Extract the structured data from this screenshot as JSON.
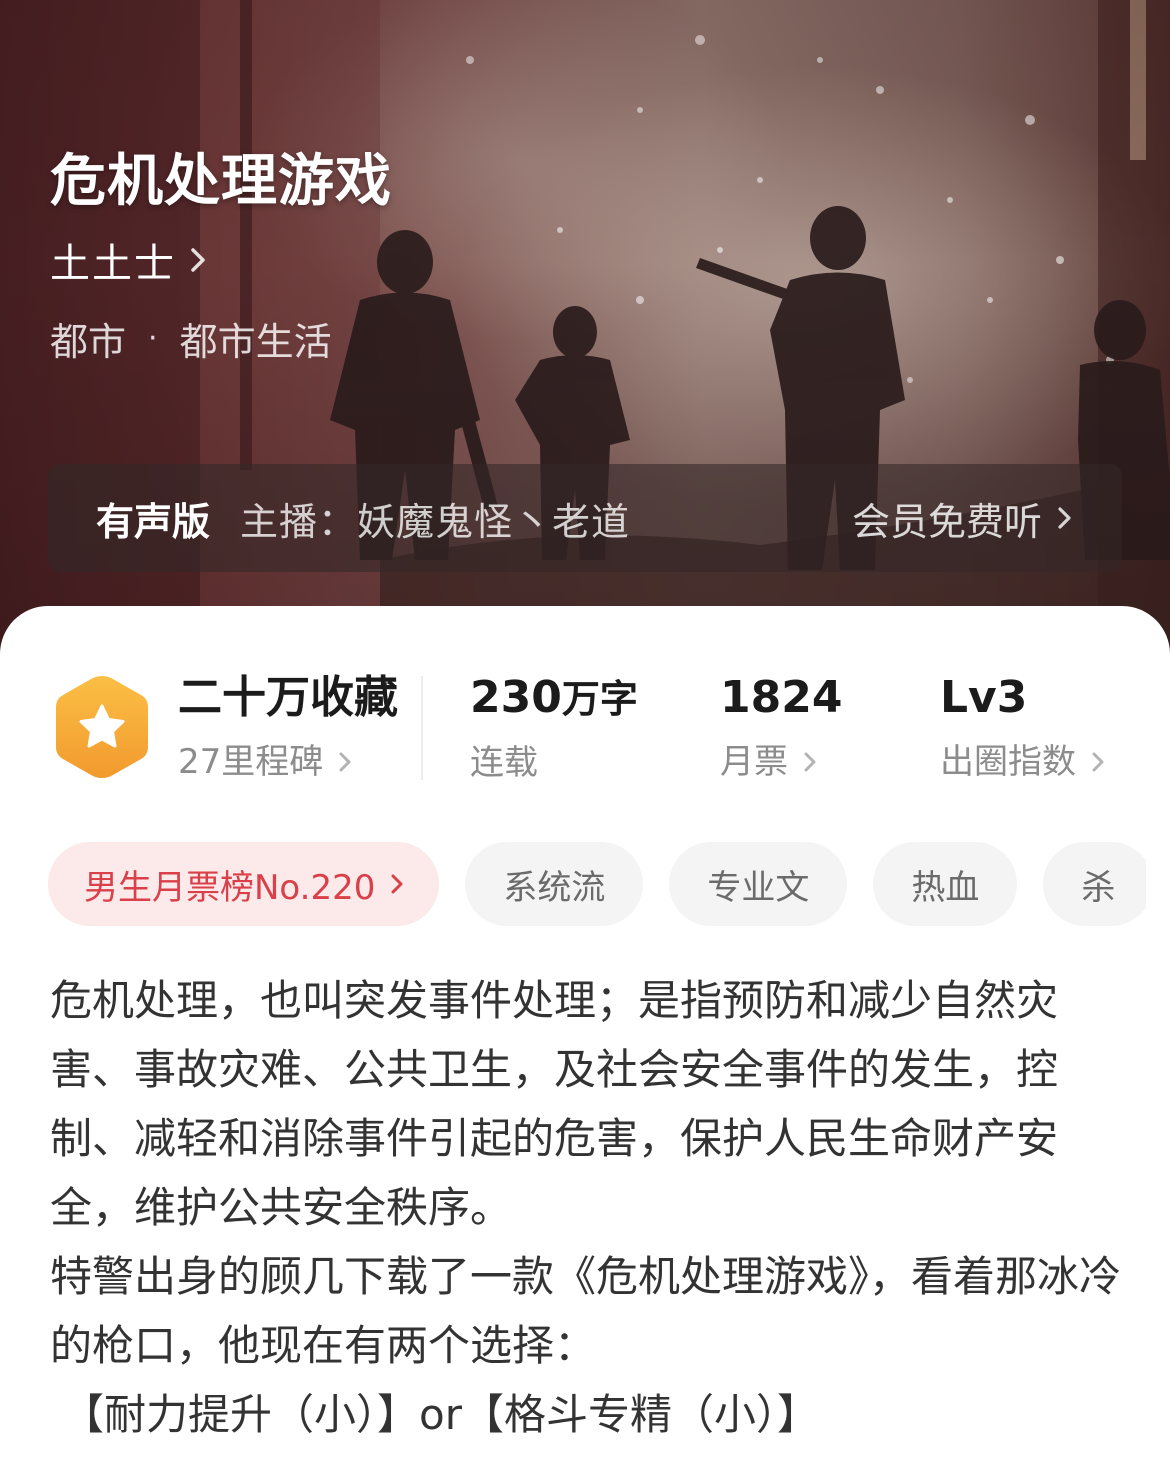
{
  "hero": {
    "title": "危机处理游戏",
    "author": "土土士",
    "category": "都市",
    "separator": "·",
    "subcategory": "都市生活",
    "audio": {
      "tag": "有声版",
      "host": "主播：妖魔鬼怪丶老道",
      "cta": "会员免费听"
    }
  },
  "stats": {
    "favorites": {
      "value": "二十万收藏",
      "label": "27里程碑"
    },
    "words": {
      "value": "230",
      "unit": "万字",
      "label": "连载"
    },
    "tickets": {
      "value": "1824",
      "label": "月票"
    },
    "influence": {
      "value": "Lv3",
      "label": "出圈指数"
    }
  },
  "tags": {
    "rank": "男生月票榜No.220",
    "items": [
      "系统流",
      "专业文",
      "热血",
      "杀"
    ]
  },
  "synopsis": {
    "paragraph1": "危机处理，也叫突发事件处理；是指预防和减少自然灾害、事故灾难、公共卫生，及社会安全事件的发生，控制、减轻和消除事件引起的危害，保护人民生命财产安全，维护公共安全秩序。",
    "paragraph2": "特警出身的顾几下载了一款《危机处理游戏》，看着那冰冷的枪口，他现在有两个选择：",
    "paragraph3": "【耐力提升（小）】or【格斗专精（小）】"
  },
  "colors": {
    "accent_red": "#d9404a",
    "badge_gold": "#f3a43a",
    "text_primary": "#1b1b1b",
    "text_secondary": "#8c8c8c"
  },
  "icons": [
    "chevron-right-icon",
    "star-hexagon-badge-icon"
  ]
}
